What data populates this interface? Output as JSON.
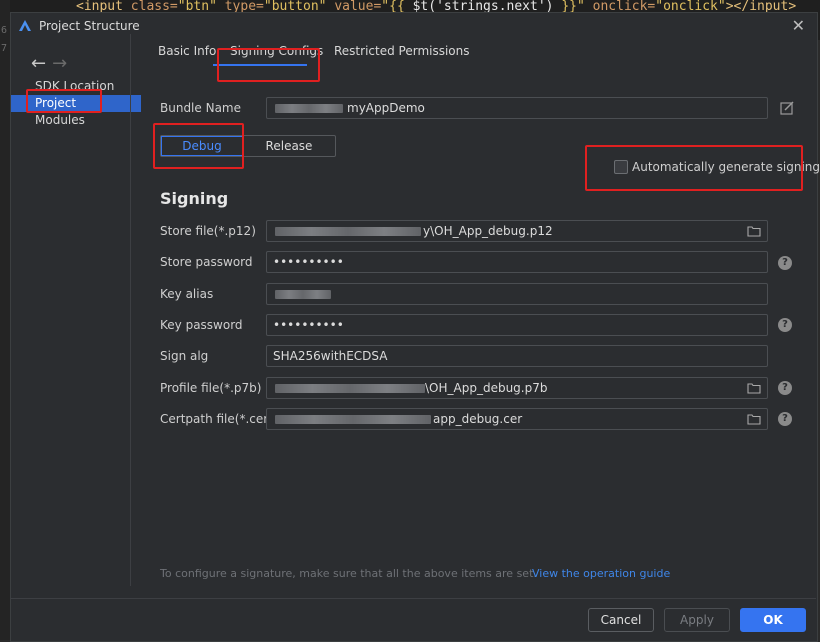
{
  "editor": {
    "gutter_numbers": [
      "6",
      "7"
    ],
    "code_parts": [
      "<input ",
      "class=",
      "\"btn\" ",
      "type=",
      "\"button\" ",
      "value=",
      "\"{{ ",
      "$t('strings.next') ",
      "}}\" ",
      "onclick=",
      "\"onclick\"",
      "></input>"
    ]
  },
  "dialog": {
    "title": "Project Structure",
    "close_glyph": "✕"
  },
  "sidebar": {
    "back_glyph": "←",
    "forward_glyph": "→",
    "items": [
      {
        "label": "SDK Location"
      },
      {
        "label": "Project",
        "selected": true
      },
      {
        "label": "Modules"
      }
    ]
  },
  "tabs": [
    {
      "label": "Basic Info"
    },
    {
      "label": "Signing Configs",
      "selected": true
    },
    {
      "label": "Restricted Permissions"
    }
  ],
  "bundle": {
    "label": "Bundle Name",
    "value_suffix": "myAppDemo"
  },
  "build_type": {
    "options": [
      "Debug",
      "Release"
    ],
    "selected": "Debug"
  },
  "auto_sign": {
    "label": "Automatically generate signing",
    "checked": false
  },
  "signing": {
    "section_title": "Signing",
    "fields": [
      {
        "label": "Store file(*.p12)",
        "value_suffix": "y\\OH_App_debug.p12"
      },
      {
        "label": "Store password",
        "value": "••••••••••"
      },
      {
        "label": "Key alias",
        "value": ""
      },
      {
        "label": "Key password",
        "value": "••••••••••"
      },
      {
        "label": "Sign alg",
        "value": "SHA256withECDSA"
      },
      {
        "label": "Profile file(*.p7b)",
        "value_suffix": "\\OH_App_debug.p7b"
      },
      {
        "label": "Certpath file(*.cer)",
        "value_suffix": "app_debug.cer"
      }
    ],
    "help_glyph": "?"
  },
  "footer": {
    "hint": "To configure a signature, make sure that all the above items are set.",
    "link": "View the operation guide",
    "buttons": {
      "cancel": "Cancel",
      "apply": "Apply",
      "ok": "OK"
    }
  },
  "colors": {
    "accent": "#3574f0",
    "highlight_box": "#e02020",
    "background": "#2b2d30"
  }
}
